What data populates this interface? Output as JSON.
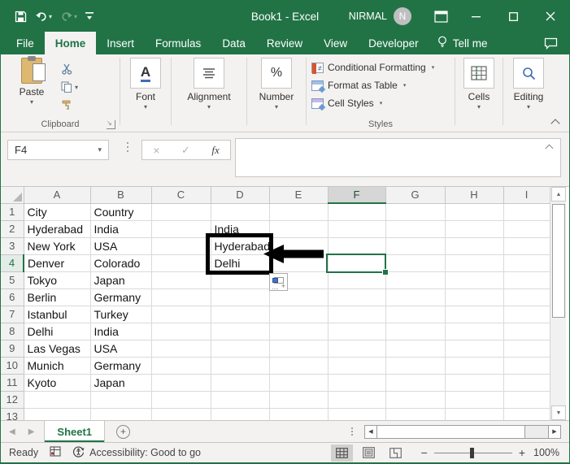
{
  "title_bar": {
    "app_title": "Book1 - Excel",
    "user_name": "NIRMAL",
    "avatar_initial": "N"
  },
  "menu": {
    "tabs": [
      "File",
      "Home",
      "Insert",
      "Formulas",
      "Data",
      "Review",
      "View",
      "Developer"
    ],
    "active_tab": "Home",
    "tell_me_label": "Tell me"
  },
  "ribbon": {
    "paste_label": "Paste",
    "clipboard_group_label": "Clipboard",
    "font_label": "Font",
    "alignment_label": "Alignment",
    "number_label": "Number",
    "number_icon_glyph": "%",
    "font_icon_glyph": "A",
    "conditional_formatting_label": "Conditional Formatting",
    "format_as_table_label": "Format as Table",
    "cell_styles_label": "Cell Styles",
    "styles_group_label": "Styles",
    "cells_label": "Cells",
    "editing_label": "Editing"
  },
  "formula_bar": {
    "name_box_value": "F4",
    "fx_label": "fx"
  },
  "grid": {
    "columns": [
      "A",
      "B",
      "C",
      "D",
      "E",
      "F",
      "G",
      "H",
      "I"
    ],
    "selected_column": "F",
    "selected_row": 4,
    "visible_rows": 13,
    "rows": [
      {
        "n": 1,
        "cells": {
          "A": "City",
          "B": "Country"
        }
      },
      {
        "n": 2,
        "cells": {
          "A": "Hyderabad",
          "B": "India",
          "D": "India"
        }
      },
      {
        "n": 3,
        "cells": {
          "A": "New York",
          "B": "USA",
          "D": "Hyderabad"
        }
      },
      {
        "n": 4,
        "cells": {
          "A": "Denver",
          "B": "Colorado",
          "D": "Delhi"
        }
      },
      {
        "n": 5,
        "cells": {
          "A": "Tokyo",
          "B": "Japan"
        }
      },
      {
        "n": 6,
        "cells": {
          "A": "Berlin",
          "B": "Germany"
        }
      },
      {
        "n": 7,
        "cells": {
          "A": "Istanbul",
          "B": "Turkey"
        }
      },
      {
        "n": 8,
        "cells": {
          "A": "Delhi",
          "B": "India"
        }
      },
      {
        "n": 9,
        "cells": {
          "A": "Las Vegas",
          "B": "USA"
        }
      },
      {
        "n": 10,
        "cells": {
          "A": "Munich",
          "B": "Germany"
        }
      },
      {
        "n": 11,
        "cells": {
          "A": "Kyoto",
          "B": "Japan"
        }
      },
      {
        "n": 12,
        "cells": {}
      },
      {
        "n": 13,
        "cells": {}
      }
    ]
  },
  "sheet_bar": {
    "sheet_name": "Sheet1"
  },
  "status_bar": {
    "mode": "Ready",
    "accessibility": "Accessibility: Good to go",
    "zoom_level": "100%"
  },
  "colors": {
    "excel_green": "#217346",
    "selection_border": "#217346",
    "annotation": "#000000"
  }
}
